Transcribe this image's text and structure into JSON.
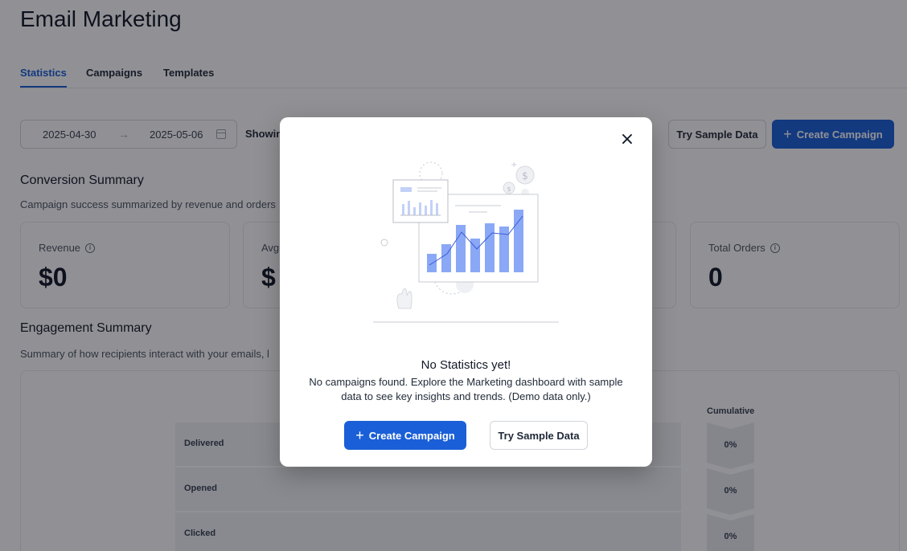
{
  "page": {
    "title": "Email Marketing",
    "tabs": [
      {
        "label": "Statistics",
        "active": true
      },
      {
        "label": "Campaigns",
        "active": false
      },
      {
        "label": "Templates",
        "active": false
      }
    ]
  },
  "filters": {
    "date_start": "2025-04-30",
    "date_end": "2025-05-06",
    "showing_label": "Showin",
    "try_sample_label": "Try Sample Data",
    "create_campaign_label": "Create Campaign"
  },
  "conversion": {
    "title": "Conversion Summary",
    "description": "Campaign success summarized by revenue and orders",
    "cards": [
      {
        "label": "Revenue",
        "value": "$0"
      },
      {
        "label": "Avg",
        "value": "$"
      },
      {
        "label": "Total Orders",
        "value": "0"
      }
    ]
  },
  "engagement": {
    "title": "Engagement Summary",
    "description": "Summary of how recipients interact with your emails, l",
    "cumulative_header": "Cumulative",
    "rows": [
      {
        "label": "Delivered",
        "cumulative": "0%"
      },
      {
        "label": "Opened",
        "cumulative": "0%"
      },
      {
        "label": "Clicked",
        "cumulative": "0%"
      }
    ]
  },
  "modal": {
    "title": "No Statistics yet!",
    "description": "No campaigns found. Explore the Marketing dashboard with sample data to see key insights and trends. (Demo data only.)",
    "create_campaign_label": "Create Campaign",
    "try_sample_label": "Try Sample Data",
    "close_symbol": "×"
  },
  "colors": {
    "primary": "#1a5fd8",
    "illustration_bar": "#8aa8f5"
  }
}
